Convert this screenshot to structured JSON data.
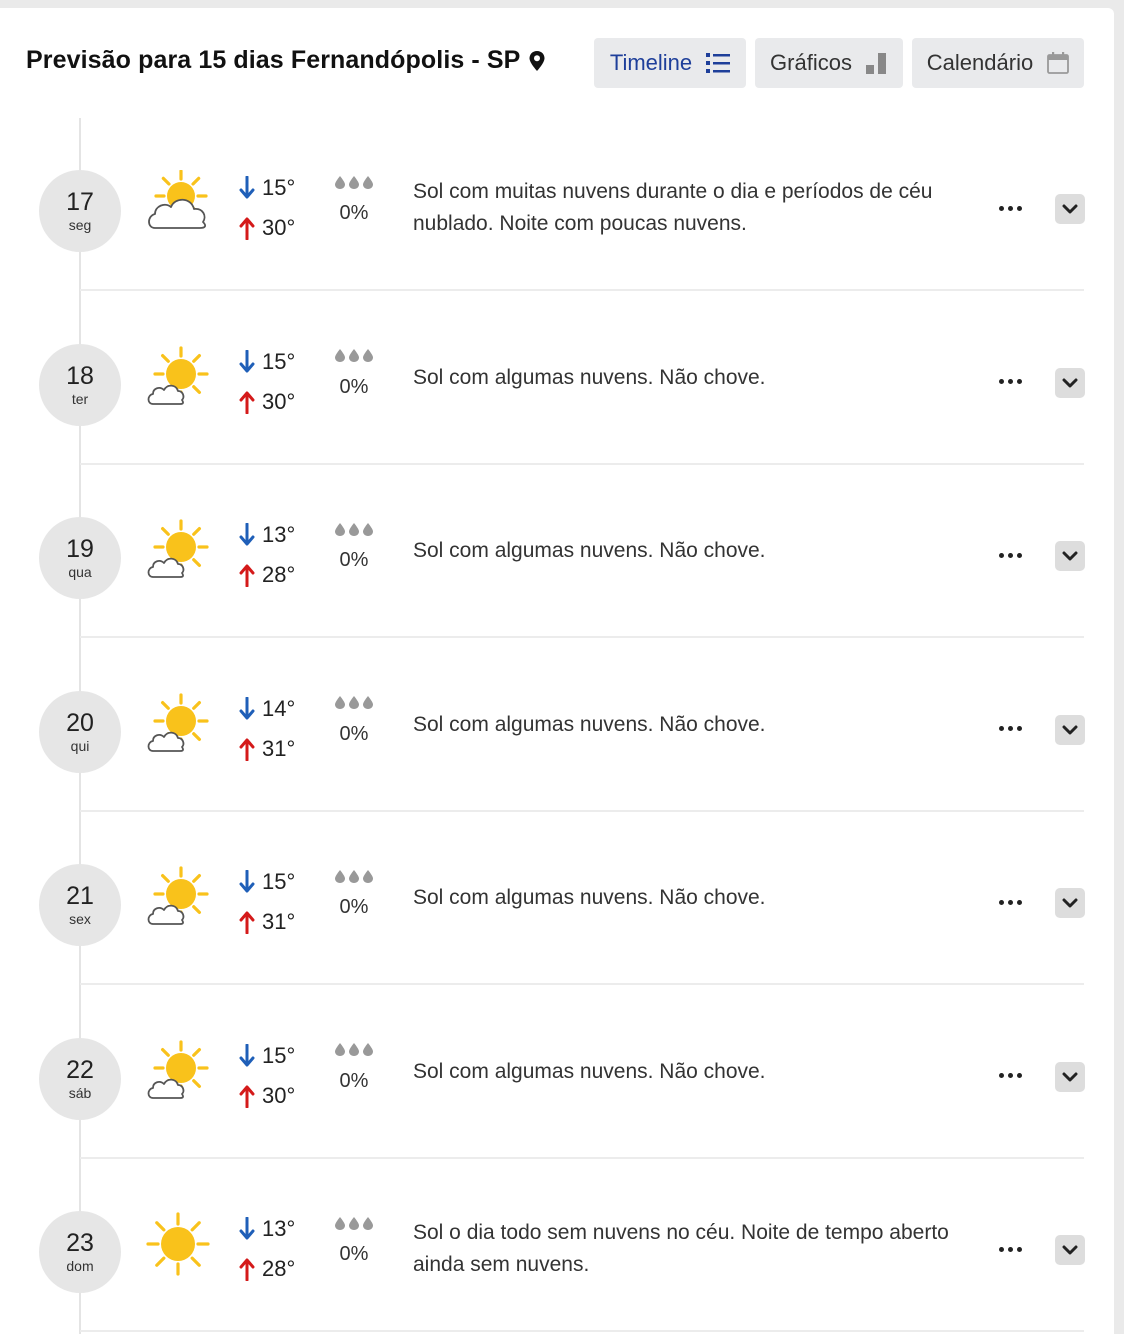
{
  "header": {
    "title": "Previsão para 15 dias Fernandópolis - SP",
    "pin_icon": "map-pin-icon",
    "views": [
      {
        "label": "Timeline",
        "icon": "list-icon",
        "active": true
      },
      {
        "label": "Gráficos",
        "icon": "bar-chart-icon",
        "active": false
      },
      {
        "label": "Calendário",
        "icon": "calendar-icon",
        "active": false
      }
    ]
  },
  "colors": {
    "accent": "#1e3f9a",
    "min_arrow": "#1f5fb8",
    "max_arrow": "#d41a1a",
    "sun": "#f9c21b"
  },
  "days": [
    {
      "day": "17",
      "dow": "seg",
      "icon": "sun-cloud-icon",
      "min": "15°",
      "max": "30°",
      "rain": "0%",
      "description": "Sol com muitas nuvens durante o dia e períodos de céu nublado. Noite com poucas nuvens."
    },
    {
      "day": "18",
      "dow": "ter",
      "icon": "sun-small-cloud-icon",
      "min": "15°",
      "max": "30°",
      "rain": "0%",
      "description": "Sol com algumas nuvens. Não chove."
    },
    {
      "day": "19",
      "dow": "qua",
      "icon": "sun-small-cloud-icon",
      "min": "13°",
      "max": "28°",
      "rain": "0%",
      "description": "Sol com algumas nuvens. Não chove."
    },
    {
      "day": "20",
      "dow": "qui",
      "icon": "sun-small-cloud-icon",
      "min": "14°",
      "max": "31°",
      "rain": "0%",
      "description": "Sol com algumas nuvens. Não chove."
    },
    {
      "day": "21",
      "dow": "sex",
      "icon": "sun-small-cloud-icon",
      "min": "15°",
      "max": "31°",
      "rain": "0%",
      "description": "Sol com algumas nuvens. Não chove."
    },
    {
      "day": "22",
      "dow": "sáb",
      "icon": "sun-small-cloud-icon",
      "min": "15°",
      "max": "30°",
      "rain": "0%",
      "description": "Sol com algumas nuvens. Não chove."
    },
    {
      "day": "23",
      "dow": "dom",
      "icon": "sun-icon",
      "min": "13°",
      "max": "28°",
      "rain": "0%",
      "description": "Sol o dia todo sem nuvens no céu. Noite de tempo aberto ainda sem nuvens."
    }
  ]
}
